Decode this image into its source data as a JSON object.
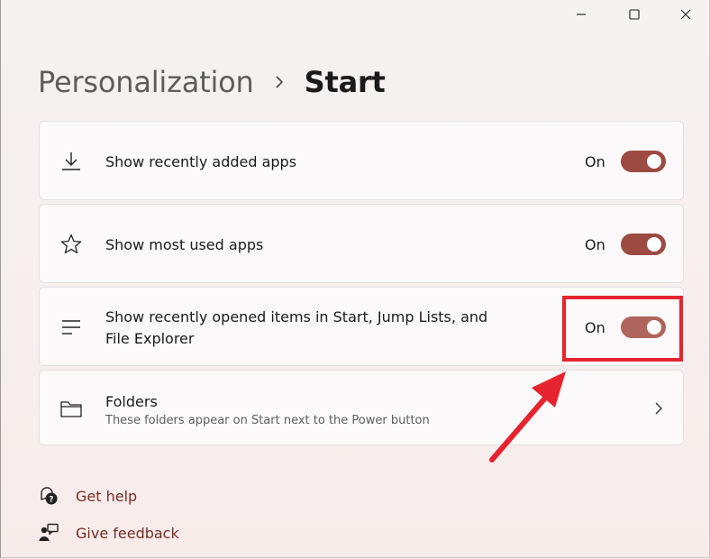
{
  "breadcrumb": {
    "parent": "Personalization",
    "current": "Start"
  },
  "settings": [
    {
      "label": "Show recently added apps",
      "state": "On",
      "icon": "download-icon"
    },
    {
      "label": "Show most used apps",
      "state": "On",
      "icon": "star-icon"
    },
    {
      "label_line1": "Show recently opened items in Start, Jump Lists, and",
      "label_line2": "File Explorer",
      "state": "On",
      "icon": "list-icon"
    }
  ],
  "folders": {
    "title": "Folders",
    "description": "These folders appear on Start next to the Power button",
    "icon": "folder-icon"
  },
  "links": {
    "help": "Get help",
    "feedback": "Give feedback"
  },
  "colors": {
    "accent": "#9c4a42",
    "link": "#7a2b24",
    "annotation": "#e6242f"
  }
}
